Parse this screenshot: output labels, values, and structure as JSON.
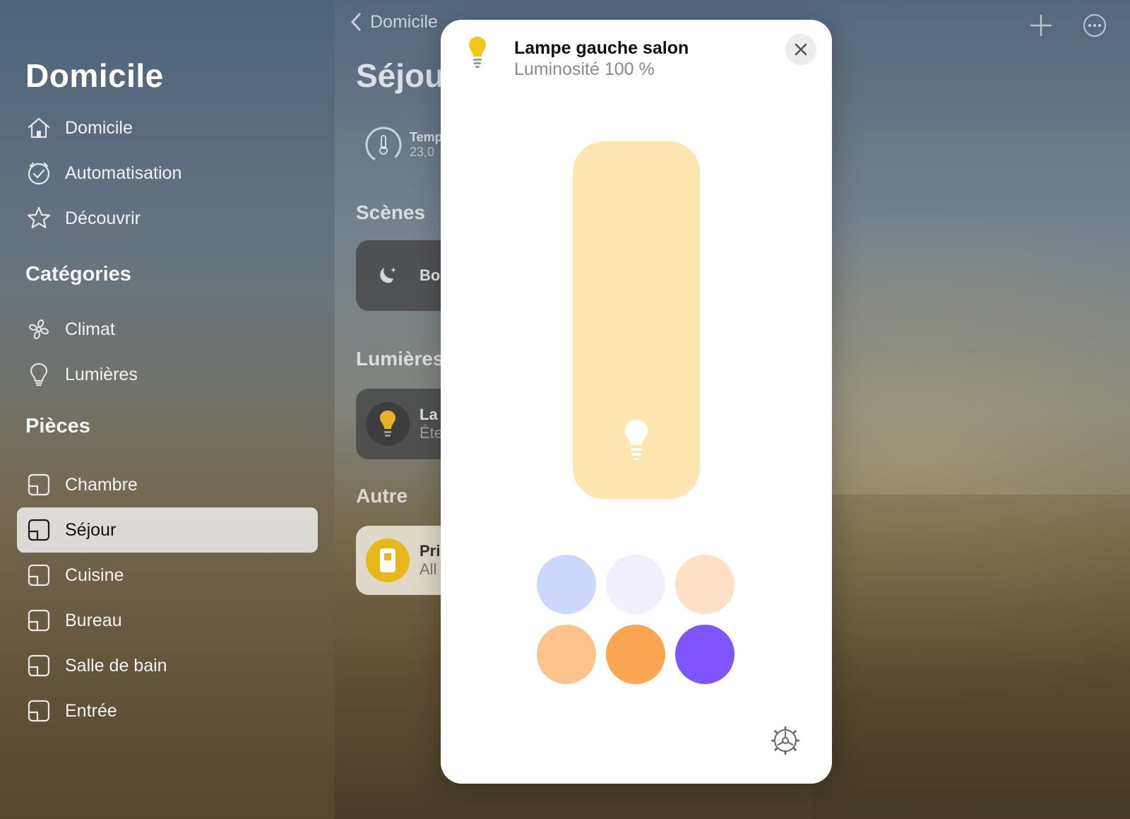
{
  "sidebar": {
    "title": "Domicile",
    "nav": [
      {
        "label": "Domicile",
        "icon": "house-icon"
      },
      {
        "label": "Automatisation",
        "icon": "clock-check-icon"
      },
      {
        "label": "Découvrir",
        "icon": "star-icon"
      }
    ],
    "categories_heading": "Catégories",
    "categories": [
      {
        "label": "Climat",
        "icon": "fan-icon"
      },
      {
        "label": "Lumières",
        "icon": "lightbulb-icon"
      }
    ],
    "rooms_heading": "Pièces",
    "rooms": [
      {
        "label": "Chambre",
        "icon": "room-icon"
      },
      {
        "label": "Séjour",
        "icon": "room-icon",
        "selected": true
      },
      {
        "label": "Cuisine",
        "icon": "room-icon"
      },
      {
        "label": "Bureau",
        "icon": "room-icon"
      },
      {
        "label": "Salle de bain",
        "icon": "room-icon"
      },
      {
        "label": "Entrée",
        "icon": "room-icon"
      }
    ]
  },
  "main": {
    "back_label": "Domicile",
    "title": "Séjou",
    "temperature": {
      "label": "Temp",
      "value": "23,0"
    },
    "scenes_heading": "Scènes",
    "scene_card": {
      "label": "Bo",
      "icon": "moon-icon"
    },
    "lights_heading": "Lumières",
    "light_card": {
      "label": "La",
      "status": "Éte",
      "icon": "lightbulb-icon"
    },
    "other_heading": "Autre",
    "other_card": {
      "label": "Pri",
      "status": "All",
      "icon": "outlet-icon"
    }
  },
  "modal": {
    "title": "Lampe gauche salon",
    "subtitle": "Luminosité 100 %",
    "brightness_fraction": 1.0,
    "slider_color": "#ffe6b0",
    "swatches": [
      "#ccd8fb",
      "#f1effc",
      "#fde0c6",
      "#fdc38a",
      "#fca553",
      "#7e55fe"
    ]
  },
  "colors": {
    "accent_bulb": "#f5c518",
    "sidebar_selected": "#ebebeb"
  }
}
